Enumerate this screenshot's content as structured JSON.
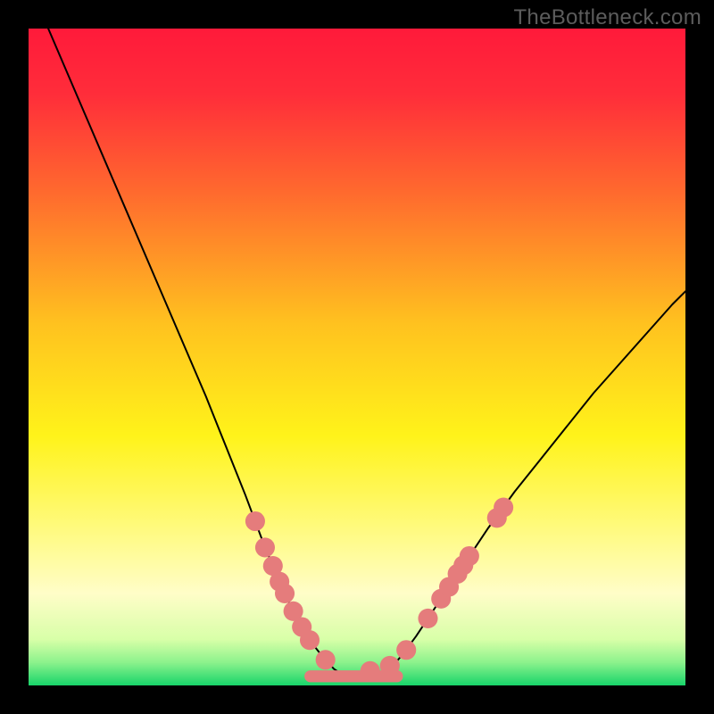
{
  "watermark": "TheBottleneck.com",
  "chart_data": {
    "type": "line",
    "title": "",
    "xlabel": "",
    "ylabel": "",
    "xlim": [
      0,
      100
    ],
    "ylim": [
      0,
      100
    ],
    "grid": false,
    "legend": false,
    "background": {
      "type": "vertical-gradient",
      "stops": [
        {
          "offset": 0.0,
          "color": "#ff1a3a"
        },
        {
          "offset": 0.1,
          "color": "#ff2d3a"
        },
        {
          "offset": 0.25,
          "color": "#ff6a2e"
        },
        {
          "offset": 0.45,
          "color": "#ffc21f"
        },
        {
          "offset": 0.62,
          "color": "#fff31a"
        },
        {
          "offset": 0.78,
          "color": "#fffb8c"
        },
        {
          "offset": 0.86,
          "color": "#fffdc8"
        },
        {
          "offset": 0.93,
          "color": "#d8ffa8"
        },
        {
          "offset": 0.965,
          "color": "#8cf28c"
        },
        {
          "offset": 1.0,
          "color": "#18d46a"
        }
      ]
    },
    "series": [
      {
        "name": "left-branch",
        "stroke": "#000000",
        "stroke_width": 2,
        "x": [
          3,
          6,
          9,
          12,
          15,
          18,
          21,
          24,
          27,
          29,
          31,
          33,
          34.5,
          36,
          37.5,
          39,
          40.2,
          41.4,
          42.6,
          43.8,
          45,
          46.5,
          48
        ],
        "y": [
          100,
          93,
          86,
          79,
          72,
          65,
          58,
          51,
          44,
          39,
          34,
          29,
          25,
          21,
          17.5,
          14,
          11.5,
          9.3,
          7.3,
          5.6,
          4.1,
          2.5,
          1.5
        ]
      },
      {
        "name": "right-branch",
        "stroke": "#000000",
        "stroke_width": 2,
        "x": [
          54,
          55.5,
          57,
          59,
          61,
          64,
          67,
          70,
          74,
          78,
          82,
          86,
          90,
          94,
          98,
          100
        ],
        "y": [
          1.5,
          3.0,
          4.8,
          7.5,
          10.5,
          15,
          19.5,
          24,
          29.5,
          34.5,
          39.5,
          44.5,
          49,
          53.5,
          58,
          60
        ]
      }
    ],
    "flat_zone": {
      "name": "flat-bottom-bar",
      "x_start": 42,
      "x_end": 57,
      "y": 1.4,
      "height_pct": 1.8,
      "color": "#e57c7c"
    },
    "markers": {
      "name": "data-points",
      "color": "#e57c7c",
      "radius_pct": 1.5,
      "points": [
        {
          "x": 34.5,
          "y": 25.0
        },
        {
          "x": 36.0,
          "y": 21.0
        },
        {
          "x": 37.2,
          "y": 18.2
        },
        {
          "x": 38.2,
          "y": 15.8
        },
        {
          "x": 39.0,
          "y": 14.0
        },
        {
          "x": 40.3,
          "y": 11.3
        },
        {
          "x": 41.6,
          "y": 8.9
        },
        {
          "x": 42.8,
          "y": 6.9
        },
        {
          "x": 45.2,
          "y": 3.9
        },
        {
          "x": 52.0,
          "y": 2.2
        },
        {
          "x": 55.0,
          "y": 3.0
        },
        {
          "x": 57.5,
          "y": 5.4
        },
        {
          "x": 60.8,
          "y": 10.2
        },
        {
          "x": 62.8,
          "y": 13.2
        },
        {
          "x": 64.0,
          "y": 15.0
        },
        {
          "x": 65.3,
          "y": 17.0
        },
        {
          "x": 66.2,
          "y": 18.3
        },
        {
          "x": 67.1,
          "y": 19.7
        },
        {
          "x": 71.3,
          "y": 25.5
        },
        {
          "x": 72.3,
          "y": 27.1
        }
      ]
    }
  }
}
